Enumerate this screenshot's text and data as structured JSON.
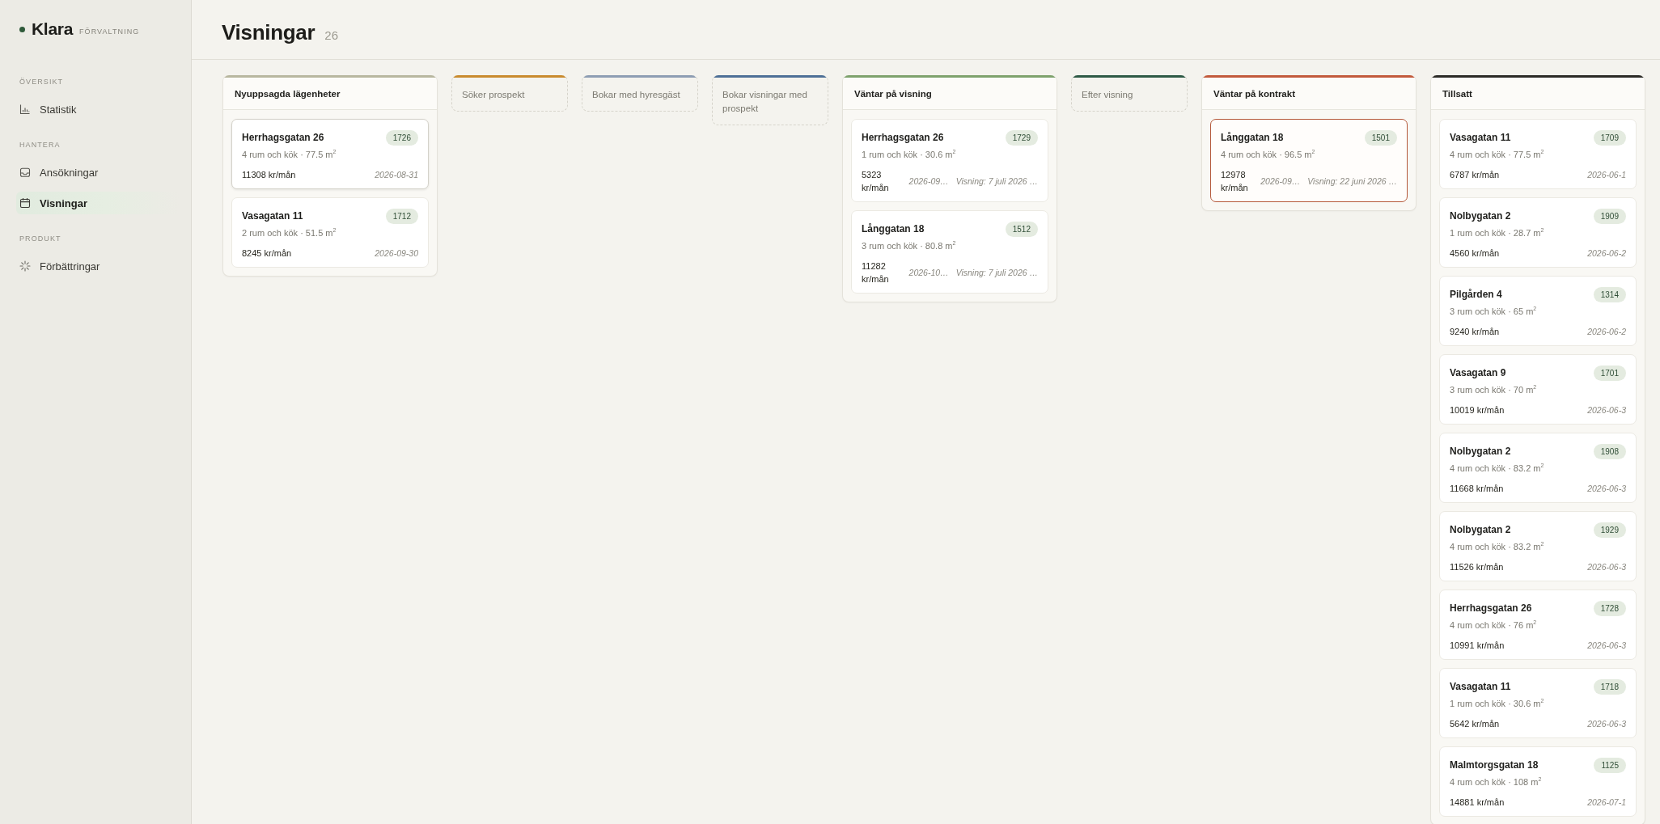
{
  "sidebar": {
    "brand": {
      "name": "Klara",
      "tagline": "FÖRVALTNING"
    },
    "sections": [
      {
        "label": "ÖVERSIKT",
        "items": [
          {
            "label": "Statistik",
            "selected": false
          }
        ]
      },
      {
        "label": "HANTERA",
        "items": [
          {
            "label": "Ansökningar",
            "selected": false
          },
          {
            "label": "Visningar",
            "selected": true
          }
        ]
      },
      {
        "label": "PRODUKT",
        "items": [
          {
            "label": "Förbättringar",
            "selected": false
          }
        ]
      }
    ]
  },
  "header": {
    "title": "Visningar",
    "count": "26"
  },
  "board": {
    "columns": [
      {
        "title": "Nyuppsagda lägenheter",
        "color": "#b8b79f",
        "cards": [
          {
            "address": "Herrhagsgatan 26",
            "number": "1726",
            "specs": "4 rum och kök · 77.5 m$^{2}$",
            "rent": "11308 kr/mån",
            "date": "2026-08-31",
            "hovered": true,
            "flagged": false
          },
          {
            "address": "Vasagatan 11",
            "number": "1712",
            "specs": "2 rum och kök · 51.5 m$^{2}$",
            "rent": "8245 kr/mån",
            "date": "2026-09-30",
            "hovered": false,
            "flagged": false
          }
        ]
      },
      {
        "title": "Söker prospekt",
        "color": "#c98b2e"
      },
      {
        "title": "Bokar med hyresgäst",
        "color": "#8e9db3"
      },
      {
        "title": "Bokar visningar med prospekt",
        "color": "#4e7097"
      },
      {
        "title": "Väntar på visning",
        "color": "#7ea26d",
        "cards": [
          {
            "address": "Herrhagsgatan 26",
            "number": "1729",
            "specs": "1 rum och kök · 30.6 m$^{2}$",
            "rent": "5323 kr/mån",
            "date": "2026-09…",
            "viewing": "Visning: 7 juli 2026 …",
            "hovered": false,
            "flagged": false
          },
          {
            "address": "Långgatan 18",
            "number": "1512",
            "specs": "3 rum och kök · 80.8 m$^{2}$",
            "rent": "11282 kr/mån",
            "date": "2026-10…",
            "viewing": "Visning: 7 juli 2026 …",
            "hovered": false,
            "flagged": false
          }
        ]
      },
      {
        "title": "Efter visning",
        "color": "#2e5a46"
      },
      {
        "title": "Väntar på kontrakt",
        "color": "#c25a3c",
        "cards": [
          {
            "address": "Långgatan 18",
            "number": "1501",
            "specs": "4 rum och kök · 96.5 m$^{2}$",
            "rent": "12978 kr/mån",
            "date": "2026-09…",
            "viewing": "Visning: 22 juni 2026 …",
            "hovered": false,
            "flagged": true
          }
        ]
      },
      {
        "title": "Tillsatt",
        "color": "#2c2b27",
        "cards": [
          {
            "address": "Vasagatan 11",
            "number": "1709",
            "specs": "4 rum och kök · 77.5 m$^{2}$",
            "rent": "6787 kr/mån",
            "date": "2026-06-1",
            "hovered": false,
            "flagged": false
          },
          {
            "address": "Nolbygatan 2",
            "number": "1909",
            "specs": "1 rum och kök · 28.7 m$^{2}$",
            "rent": "4560 kr/mån",
            "date": "2026-06-2",
            "hovered": false,
            "flagged": false
          },
          {
            "address": "Pilgården 4",
            "number": "1314",
            "specs": "3 rum och kök · 65 m$^{2}$",
            "rent": "9240 kr/mån",
            "date": "2026-06-2",
            "hovered": false,
            "flagged": false
          },
          {
            "address": "Vasagatan 9",
            "number": "1701",
            "specs": "3 rum och kök · 70 m$^{2}$",
            "rent": "10019 kr/mån",
            "date": "2026-06-3",
            "hovered": false,
            "flagged": false
          },
          {
            "address": "Nolbygatan 2",
            "number": "1908",
            "specs": "4 rum och kök · 83.2 m$^{2}$",
            "rent": "11668 kr/mån",
            "date": "2026-06-3",
            "hovered": false,
            "flagged": false
          },
          {
            "address": "Nolbygatan 2",
            "number": "1929",
            "specs": "4 rum och kök · 83.2 m$^{2}$",
            "rent": "11526 kr/mån",
            "date": "2026-06-3",
            "hovered": false,
            "flagged": false
          },
          {
            "address": "Herrhagsgatan 26",
            "number": "1728",
            "specs": "4 rum och kök · 76 m$^{2}$",
            "rent": "10991 kr/mån",
            "date": "2026-06-3",
            "hovered": false,
            "flagged": false
          },
          {
            "address": "Vasagatan 11",
            "number": "1718",
            "specs": "1 rum och kök · 30.6 m$^{2}$",
            "rent": "5642 kr/mån",
            "date": "2026-06-3",
            "hovered": false,
            "flagged": false
          },
          {
            "address": "Malmtorgsgatan 18",
            "number": "1125",
            "specs": "4 rum och kök · 108 m$^{2}$",
            "rent": "14881 kr/mån",
            "date": "2026-07-1",
            "hovered": false,
            "flagged": false
          }
        ]
      }
    ]
  }
}
